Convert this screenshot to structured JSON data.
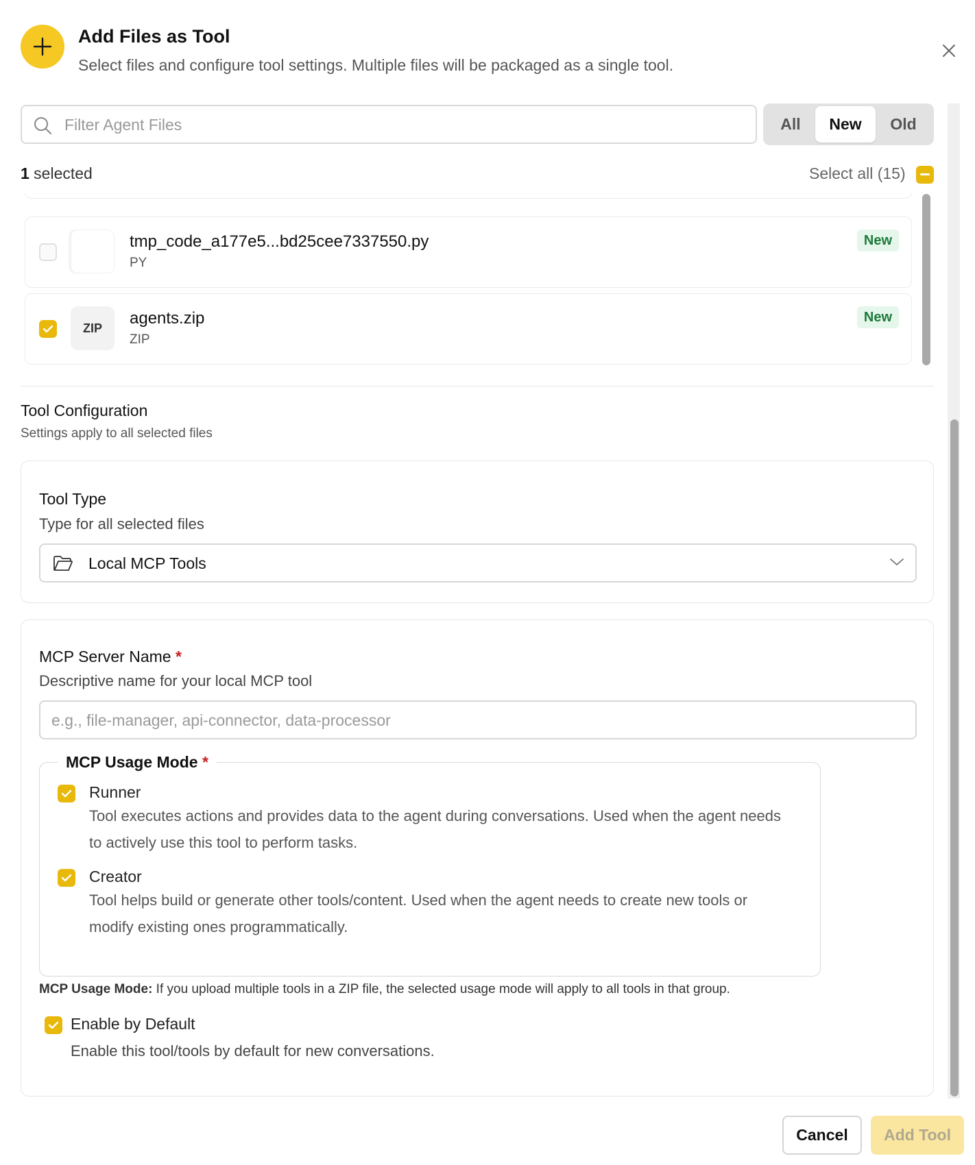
{
  "header": {
    "title": "Add Files as Tool",
    "subtitle": "Select files and configure tool settings. Multiple files will be packaged as a single tool.",
    "icon": "plus-icon",
    "accent_color": "#f6c823"
  },
  "filter": {
    "placeholder": "Filter Agent Files",
    "value": "",
    "segments": [
      "All",
      "New",
      "Old"
    ],
    "active_segment": "New"
  },
  "selection": {
    "count": "1",
    "count_suffix": " selected",
    "select_all_label": "Select all (15)",
    "select_all_state": "indeterminate"
  },
  "files": [
    {
      "name": "tmp_code_a177e5...bd25cee7337550.py",
      "type": "PY",
      "thumb": "",
      "badge": "New",
      "checked": false
    },
    {
      "name": "agents.zip",
      "type": "ZIP",
      "thumb": "ZIP",
      "badge": "New",
      "checked": true
    }
  ],
  "config": {
    "title": "Tool Configuration",
    "subtitle": "Settings apply to all selected files",
    "tool_type": {
      "label": "Tool Type",
      "description": "Type for all selected files",
      "value": "Local MCP Tools",
      "icon": "folder-icon"
    },
    "server_name": {
      "label": "MCP Server Name",
      "required_mark": "*",
      "description": "Descriptive name for your local MCP tool",
      "placeholder": "e.g., file-manager, api-connector, data-processor",
      "value": ""
    },
    "usage_mode": {
      "legend": "MCP Usage Mode",
      "required_mark": "*",
      "options": [
        {
          "label": "Runner",
          "description": "Tool executes actions and provides data to the agent during conversations. Used when the agent needs to actively use this tool to perform tasks.",
          "checked": true
        },
        {
          "label": "Creator",
          "description": "Tool helps build or generate other tools/content. Used when the agent needs to create new tools or modify existing ones programmatically.",
          "checked": true
        }
      ],
      "note_bold": "MCP Usage Mode:",
      "note_text": " If you upload multiple tools in a ZIP file, the selected usage mode will apply to all tools in that group."
    },
    "enable_default": {
      "label": "Enable by Default",
      "description": "Enable this tool/tools by default for new conversations.",
      "checked": true
    }
  },
  "footer": {
    "cancel_label": "Cancel",
    "add_label": "Add Tool"
  }
}
